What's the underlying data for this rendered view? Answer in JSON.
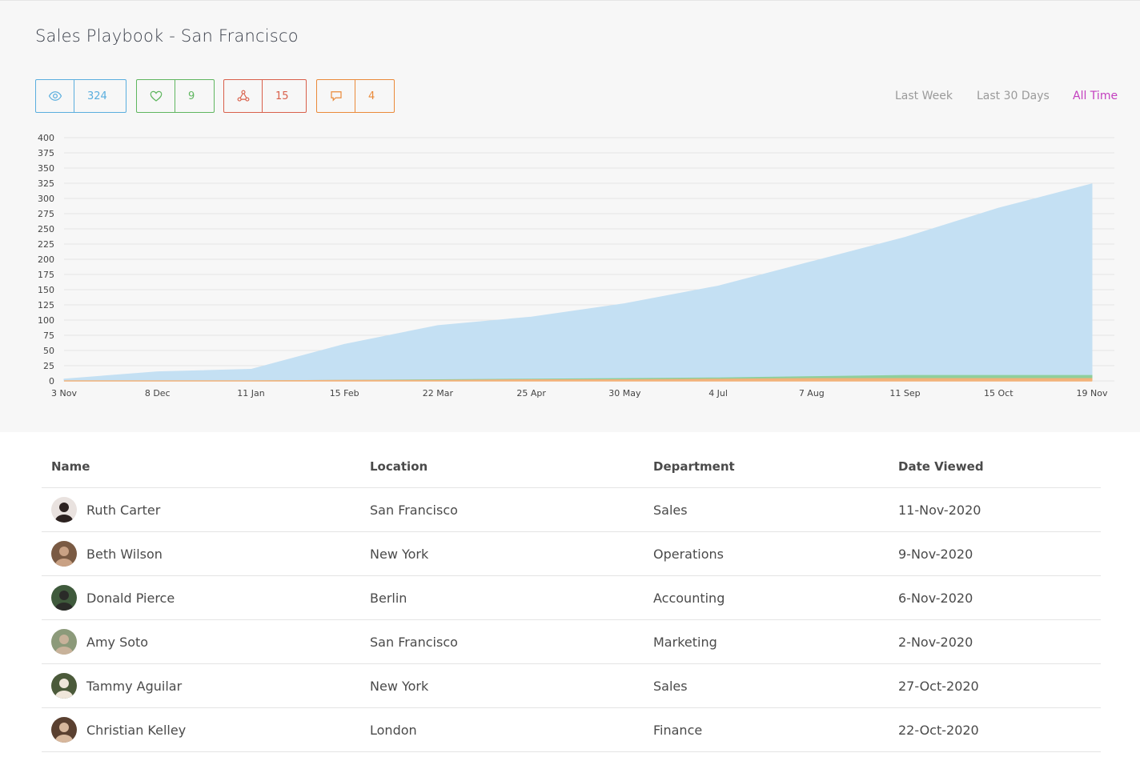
{
  "title": "Sales Playbook - San Francisco",
  "stats": [
    {
      "icon": "eye-icon",
      "value": "324",
      "color": "#5aaede"
    },
    {
      "icon": "heart-icon",
      "value": "9",
      "color": "#5fb65f"
    },
    {
      "icon": "share-icon",
      "value": "15",
      "color": "#d9604b"
    },
    {
      "icon": "comment-icon",
      "value": "4",
      "color": "#ea8a3a"
    }
  ],
  "ranges": {
    "last_week": "Last Week",
    "last_30_days": "Last 30 Days",
    "all_time": "All Time",
    "active_color": "#c33fbf"
  },
  "chart_data": {
    "type": "area",
    "x": [
      "3 Nov",
      "8 Dec",
      "11 Jan",
      "15 Feb",
      "22 Mar",
      "25 Apr",
      "30 May",
      "4 Jul",
      "7 Aug",
      "11 Sep",
      "15 Oct",
      "19 Nov"
    ],
    "series": [
      {
        "values": [
          3,
          15,
          19,
          60,
          91,
          105,
          127,
          156,
          196,
          236,
          284,
          324
        ],
        "color": "#c4e0f3"
      },
      {
        "values": [
          0,
          0,
          0,
          1,
          2,
          3,
          4,
          5,
          7,
          9,
          9,
          9
        ],
        "color": "#8fcf9b"
      },
      {
        "values": [
          0,
          0,
          0,
          1,
          1,
          2,
          2,
          3,
          4,
          4,
          4,
          4
        ],
        "color": "#f2b27a"
      }
    ],
    "yticks": [
      0,
      25,
      50,
      75,
      100,
      125,
      150,
      175,
      200,
      225,
      250,
      275,
      300,
      325,
      350,
      375,
      400
    ],
    "ylim": [
      0,
      400
    ],
    "grid": true
  },
  "table": {
    "headers": {
      "name": "Name",
      "location": "Location",
      "department": "Department",
      "date": "Date Viewed"
    },
    "rows": [
      {
        "name": "Ruth Carter",
        "location": "San Francisco",
        "department": "Sales",
        "date": "11-Nov-2020",
        "avatar_bg": "#e9e2df",
        "avatar_fg": "#2c2220"
      },
      {
        "name": "Beth Wilson",
        "location": "New York",
        "department": "Operations",
        "date": "9-Nov-2020",
        "avatar_bg": "#7a5a43",
        "avatar_fg": "#c9a184"
      },
      {
        "name": "Donald Pierce",
        "location": "Berlin",
        "department": "Accounting",
        "date": "6-Nov-2020",
        "avatar_bg": "#3f5a3c",
        "avatar_fg": "#2a2b28"
      },
      {
        "name": "Amy Soto",
        "location": "San Francisco",
        "department": "Marketing",
        "date": "2-Nov-2020",
        "avatar_bg": "#8c9a7a",
        "avatar_fg": "#c8b29a"
      },
      {
        "name": "Tammy Aguilar",
        "location": "New York",
        "department": "Sales",
        "date": "27-Oct-2020",
        "avatar_bg": "#4b5a3a",
        "avatar_fg": "#efe6da"
      },
      {
        "name": "Christian Kelley",
        "location": "London",
        "department": "Finance",
        "date": "22-Oct-2020",
        "avatar_bg": "#5a4030",
        "avatar_fg": "#d7b79c"
      }
    ]
  }
}
